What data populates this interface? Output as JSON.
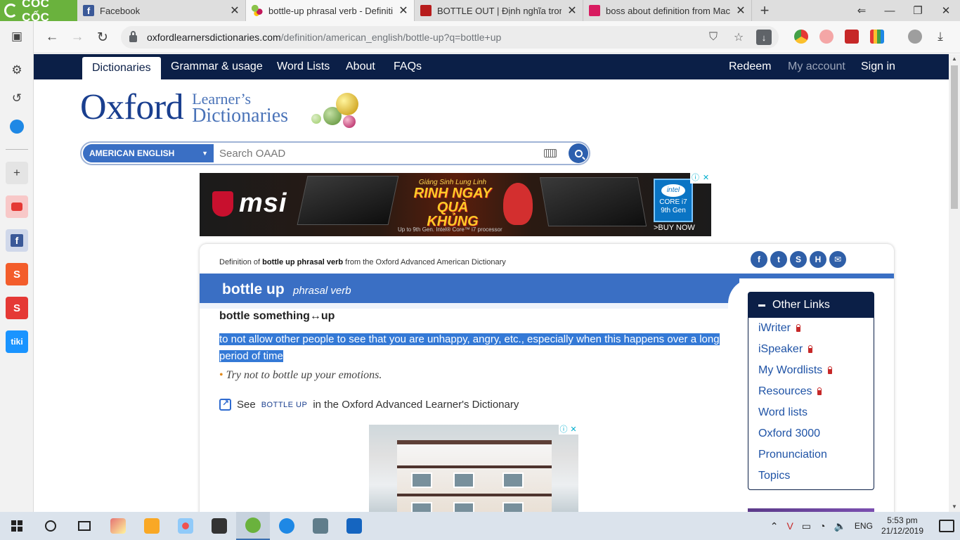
{
  "browser": {
    "logo_text": "CỐC CỐC",
    "tabs": [
      {
        "title": "Facebook",
        "favicon": "facebook-icon"
      },
      {
        "title": "bottle-up phrasal verb - Definition",
        "favicon": "oxford-icon",
        "active": true
      },
      {
        "title": "BOTTLE OUT | Định nghĩa trong Từ",
        "favicon": "cambridge-icon"
      },
      {
        "title": "boss about definition from Macmil",
        "favicon": "macmillan-icon"
      }
    ],
    "url_domain": "oxfordlearnersdictionaries.com",
    "url_path": "/definition/american_english/bottle-up?q=bottle+up"
  },
  "site": {
    "nav": {
      "dictionaries": "Dictionaries",
      "grammar": "Grammar & usage",
      "word_lists": "Word Lists",
      "about": "About",
      "faqs": "FAQs",
      "redeem": "Redeem",
      "my_account": "My account",
      "sign_in": "Sign in"
    },
    "logo": {
      "oxford": "Oxford",
      "learners": "Learner’s",
      "dictionaries": "Dictionaries"
    },
    "search": {
      "language": "AMERICAN ENGLISH",
      "placeholder": "Search OAAD"
    }
  },
  "ad_top": {
    "brand": "msi",
    "promo_line1": "Giáng Sinh Lung Linh",
    "promo_line2": "RINH NGAY",
    "promo_line3": "QUÀ KHỦNG",
    "small_text": "Up to 9th Gen. Intel® Core™ i7 processor",
    "badge_intel": "intel",
    "badge_core": "CORE i7",
    "badge_gen": "9th Gen",
    "cta": ">BUY NOW",
    "info": "ⓘ",
    "close": "✕"
  },
  "entry": {
    "definition_of_prefix": "Definition of",
    "definition_of_word": "bottle up phrasal verb",
    "definition_of_suffix": "from the Oxford Advanced American Dictionary",
    "headword": "bottle up",
    "pos": "phrasal verb",
    "sense_head": "bottle something↔up",
    "definition": "to not allow other people to see that you are unhappy, angry, etc., especially when this happens over a long period of time",
    "example_bullet": "•",
    "example": "Try not to bottle up your emotions.",
    "see_prefix": "See",
    "see_word": "bottle up",
    "see_suffix": "in the Oxford Advanced Learner's Dictionary"
  },
  "social": [
    "f",
    "t",
    "S",
    "H",
    "✉"
  ],
  "other_links": {
    "title": "Other Links",
    "items": [
      {
        "label": "iWriter",
        "locked": true
      },
      {
        "label": "iSpeaker",
        "locked": true
      },
      {
        "label": "My Wordlists",
        "locked": true
      },
      {
        "label": "Resources",
        "locked": true
      },
      {
        "label": "Word lists",
        "locked": false
      },
      {
        "label": "Oxford 3000",
        "locked": false
      },
      {
        "label": "Pronunciation",
        "locked": false
      },
      {
        "label": "Topics",
        "locked": false
      }
    ]
  },
  "taskbar": {
    "language": "ENG",
    "time": "5:53 pm",
    "date": "21/12/2019"
  },
  "colors": {
    "navy": "#0b1f47",
    "oxford_blue": "#3a6fc4",
    "selection": "#3479d6",
    "coccoc_green": "#6ab23d"
  }
}
